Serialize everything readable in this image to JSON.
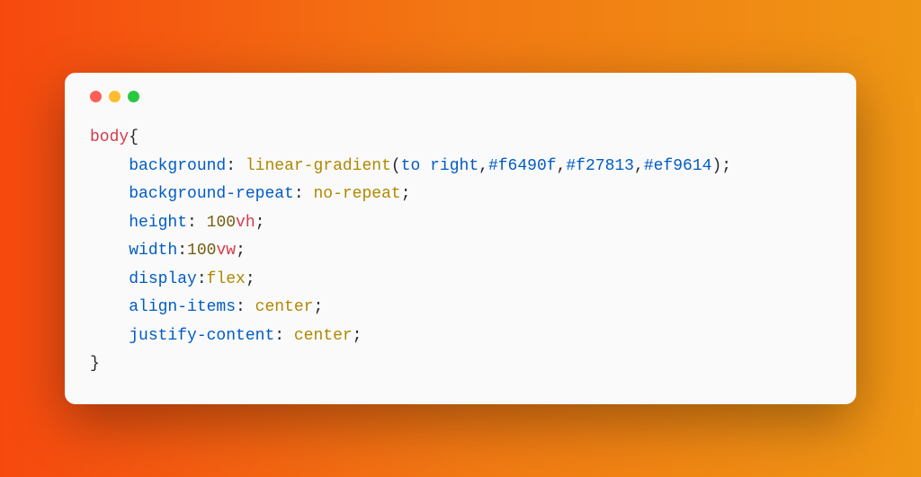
{
  "code": {
    "line1": {
      "selector": "body",
      "open_brace": "{"
    },
    "line2": {
      "indent": "    ",
      "property": "background",
      "colon": ": ",
      "func": "linear-gradient",
      "open_paren": "(",
      "arg1": "to right",
      "comma1": ",",
      "arg2": "#f6490f",
      "comma2": ",",
      "arg3": "#f27813",
      "comma3": ",",
      "arg4": "#ef9614",
      "close_paren": ")",
      "semicolon": ";"
    },
    "line3": {
      "indent": "    ",
      "property": "background-repeat",
      "colon": ": ",
      "value": "no-repeat",
      "semicolon": ";"
    },
    "line4": {
      "indent": "    ",
      "property": "height",
      "colon": ": ",
      "number": "100",
      "unit": "vh",
      "semicolon": ";"
    },
    "line5": {
      "indent": "    ",
      "property": "width",
      "colon": ":",
      "number": "100",
      "unit": "vw",
      "semicolon": ";"
    },
    "line6": {
      "indent": "    ",
      "property": "display",
      "colon": ":",
      "value": "flex",
      "semicolon": ";"
    },
    "line7": {
      "indent": "    ",
      "property": "align-items",
      "colon": ": ",
      "value": "center",
      "semicolon": ";"
    },
    "line8": {
      "indent": "    ",
      "property": "justify-content",
      "colon": ": ",
      "value": "center",
      "semicolon": ";"
    },
    "line9": {
      "close_brace": "}"
    }
  }
}
